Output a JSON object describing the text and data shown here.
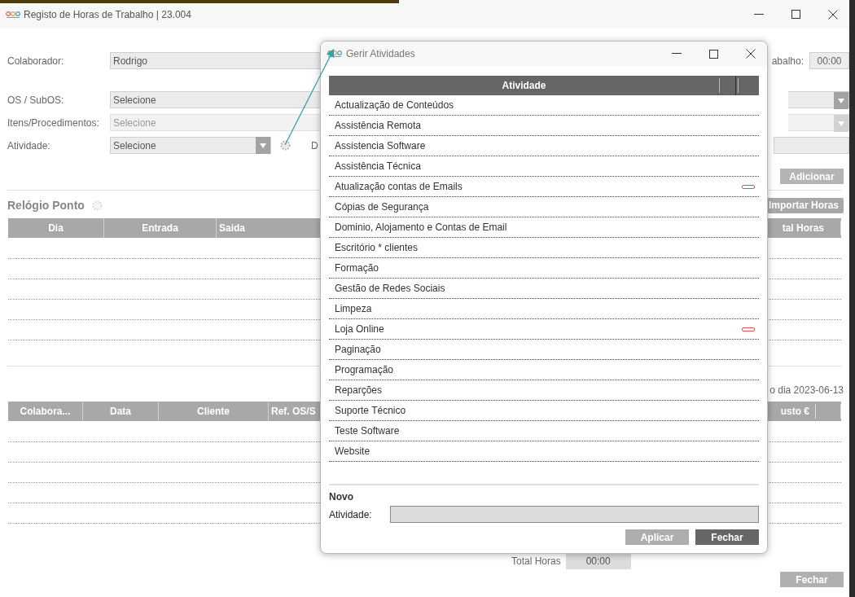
{
  "window": {
    "title": "Registo de Horas de Trabalho | 23.004"
  },
  "form": {
    "fields": [
      {
        "label": "Colaborador:",
        "value": "Rodrigo",
        "kind": "text",
        "disabled": false
      },
      {
        "label": "OS / SubOS:",
        "value": "Selecione",
        "kind": "select",
        "disabled": false
      },
      {
        "label": "Itens/Procedimentos:",
        "value": "Selecione",
        "kind": "select",
        "disabled": true
      },
      {
        "label": "Atividade:",
        "value": "Selecione",
        "kind": "select_gear",
        "disabled": false,
        "next_label": "D"
      }
    ],
    "hours_label": "abalho:",
    "hours_value": "00:00",
    "add_button": {
      "label": "Adicionar",
      "disabled": true
    }
  },
  "clock": {
    "title": "Relógio Ponto",
    "import_button": "Importar Horas",
    "columns_left": [
      "Dia",
      "Entrada",
      "Saida"
    ],
    "columns_right": [
      "tal Horas"
    ]
  },
  "summary": {
    "caption": "o dia 2023-06-13",
    "columns_left": [
      "Colabora...",
      "Data",
      "Cliente",
      "Ref. OS/S"
    ],
    "columns_right": [
      "usto €"
    ]
  },
  "total": {
    "label": "Total Horas",
    "value": "00:00"
  },
  "close_button": "Fechar",
  "dialog": {
    "title": "Gerir Atividades",
    "column": "Atividade",
    "items": [
      {
        "label": "Actualização de Conteúdos",
        "removable": false
      },
      {
        "label": "Assistência Remota",
        "removable": false
      },
      {
        "label": "Assistencia Software",
        "removable": false
      },
      {
        "label": "Assistência Técnica",
        "removable": false
      },
      {
        "label": "Atualização contas de Emails",
        "removable": true
      },
      {
        "label": "Cópias de Segurança",
        "removable": false
      },
      {
        "label": "Dominio, Alojamento e Contas de Email",
        "removable": false
      },
      {
        "label": "Escritório * clientes",
        "removable": false
      },
      {
        "label": "Formação",
        "removable": false
      },
      {
        "label": "Gestão de Redes Sociais",
        "removable": false
      },
      {
        "label": "Limpeza",
        "removable": false
      },
      {
        "label": "Loja Online",
        "removable": true
      },
      {
        "label": "Paginação",
        "removable": false
      },
      {
        "label": "Programação",
        "removable": false
      },
      {
        "label": "Reparções",
        "removable": false
      },
      {
        "label": "Suporte Técnico",
        "removable": false
      },
      {
        "label": "Teste Software",
        "removable": false
      },
      {
        "label": "Website",
        "removable": false
      }
    ],
    "new_title": "Novo",
    "new_label": "Atividade:",
    "buttons": [
      {
        "label": "Aplicar",
        "kind": "disabled"
      },
      {
        "label": "Fechar",
        "kind": "primary"
      }
    ]
  }
}
